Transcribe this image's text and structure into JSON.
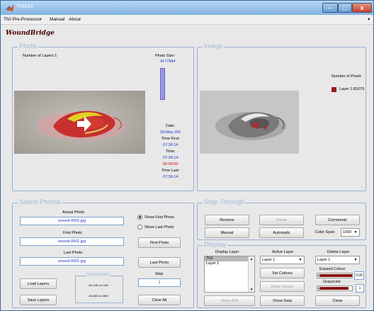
{
  "window": {
    "title": "TiVi103",
    "min": "–",
    "max": "□",
    "close": "x"
  },
  "menu": [
    "TiVi Pre-Processor",
    "Manual",
    "About"
  ],
  "menu_overflow": "▾",
  "logo": "WoundBridge",
  "photo_panel": {
    "title": "Photo",
    "layers_text": "Number of Layers:1",
    "photo_size_label": "Photo Size:",
    "photo_size_value": "4177584",
    "date_label": "Date:",
    "date_value": "29-May-201",
    "time_first_label": "Time First:",
    "time_first_value": "07:36:14",
    "time_label": "Time:",
    "time_value": "07:36:14",
    "elapsed_value": "00:00:00",
    "time_last_label": "Time Last:",
    "time_last_value": "07:36:14"
  },
  "image_panel": {
    "title": "Image",
    "pixels_label": "Number of Pixels",
    "legend_entry": "Layer 1:81679",
    "legend_color": "#9a1a1a"
  },
  "select_photos": {
    "title": "Select Photos",
    "actual_label": "Actual Photo",
    "actual_value": "wound-0001.jpg",
    "first_label": "First Photo",
    "first_value": "wound-0001.jpg",
    "last_label": "Last Photo",
    "last_value": "wound-0001.jpg",
    "show_first": "Show First Photo",
    "show_last": "Show Last Photo",
    "first_btn": "First Photo",
    "last_btn": "Last Photo",
    "step_label": "Step",
    "step_value": "1",
    "load_layers": "Load Layers",
    "save_layers": "Save Layers",
    "clear_all": "Clear All",
    "coords_title": "Coordinates",
    "coords_row1": "x0=145   x1=145",
    "coords_row2": "x0=860   x1=860"
  },
  "step_through": {
    "title": "Step Through",
    "reverse": "Reverse",
    "pause": "Pause",
    "comments": "Comments",
    "manual": "Manual",
    "automatic": "Automatic",
    "color_span_label": "Color Span",
    "color_span_value": "1000"
  },
  "display": {
    "title": "Display",
    "display_layer_label": "Display Layer",
    "list_items": [
      "TiVi",
      "Layer 1"
    ],
    "active_layer_label": "Active Layer",
    "active_layer_value": "Layer 1",
    "delete_layer_label": "Delete Layer",
    "delete_layer_value": "Layer 1",
    "set_colours": "Set Colours",
    "expand_colour_label": "Expand Colour",
    "expand_value": "0.05",
    "show_curves": "Show Curves",
    "grayscale_label": "Grayscale",
    "grayscale_value": "1",
    "show_roi": "Show ROI",
    "show_data": "Show Data",
    "close": "Close"
  }
}
